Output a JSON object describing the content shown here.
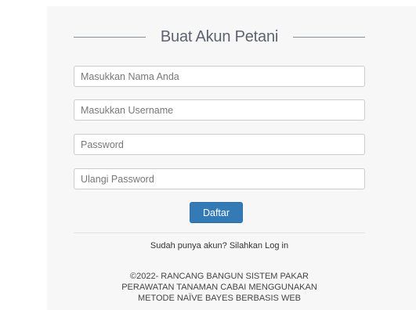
{
  "form": {
    "title": "Buat Akun Petani",
    "fields": [
      {
        "placeholder": "Masukkan Nama Anda",
        "value": ""
      },
      {
        "placeholder": "Masukkan Username",
        "value": ""
      },
      {
        "placeholder": "Password",
        "value": ""
      },
      {
        "placeholder": "Ulangi Password",
        "value": ""
      }
    ],
    "submit_label": "Daftar",
    "login_link": "Sudah punya akun? Silahkan Log in"
  },
  "footer": {
    "lines": [
      "©2022- RANCANG BANGUN SISTEM PAKAR",
      "PERAWATAN TANAMAN CABAI MENGGUNAKAN",
      "METODE NAÏVE BAYES BERBASIS WEB"
    ]
  },
  "colors": {
    "primary_button": "#337ab7",
    "background": "#f7f7f7"
  }
}
